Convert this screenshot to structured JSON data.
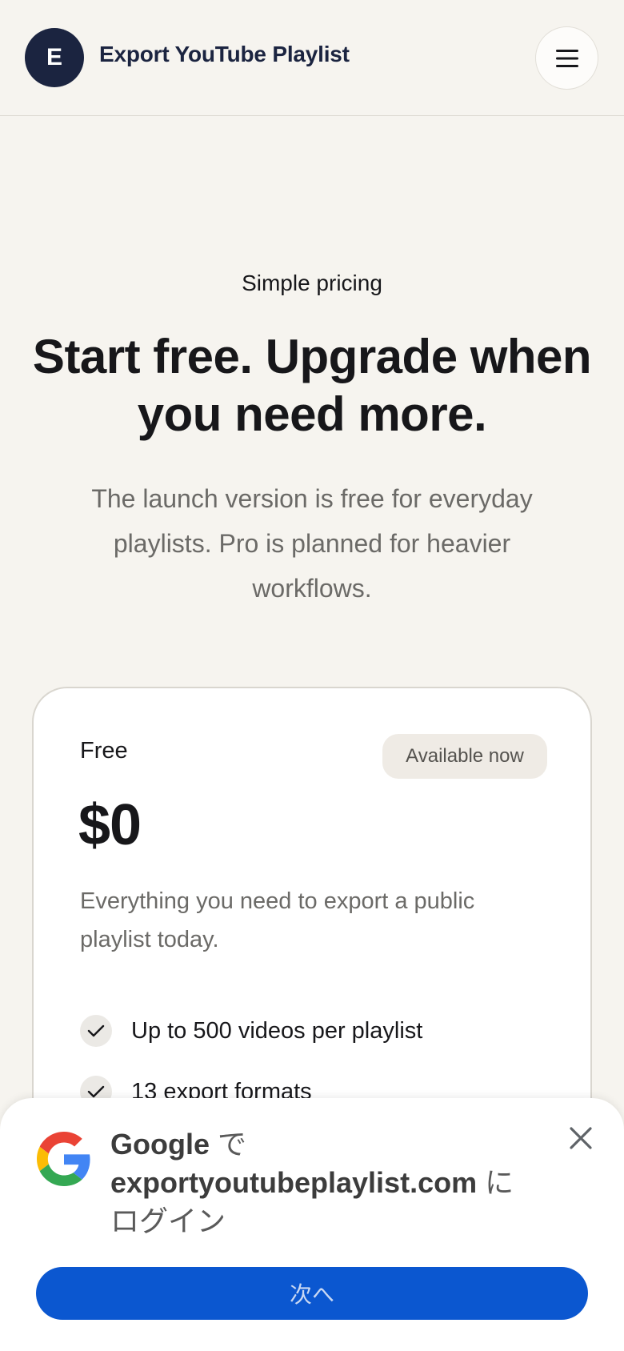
{
  "header": {
    "logo_letter": "E",
    "brand": "Export YouTube Playlist",
    "menu_icon": "hamburger-icon"
  },
  "hero": {
    "eyebrow": "Simple pricing",
    "headline": "Start free. Upgrade when you need more.",
    "subtext": "The launch version is free for everyday playlists. Pro is planned for heavier workflows."
  },
  "plan": {
    "name": "Free",
    "badge": "Available now",
    "price": "$0",
    "description": "Everything you need to export a public playlist today.",
    "features": [
      "Up to 500 videos per playlist",
      "13 export formats"
    ]
  },
  "google_sheet": {
    "title_brand": "Google",
    "title_part1": " で",
    "site": "exportyoutubeplaylist.com",
    "title_part2": " に",
    "title_part3": "ログイン",
    "next_button": "次へ",
    "colors": {
      "button": "#0b57d0"
    }
  }
}
